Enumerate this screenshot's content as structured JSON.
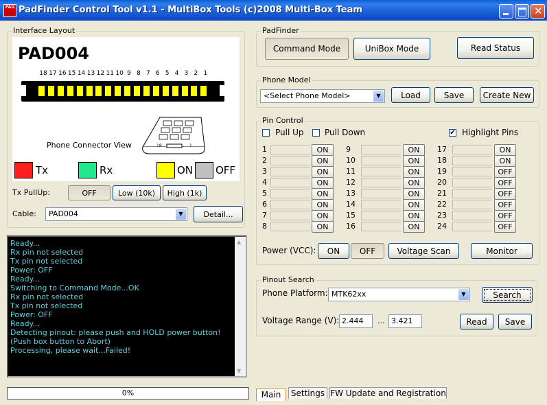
{
  "window": {
    "title": "PadFinder Control Tool v1.1 - MultiBox Tools (c)2008 Multi-Box Team",
    "icon_text": "PAD"
  },
  "interface": {
    "group_label": "Interface Layout",
    "pad_name": "PAD004",
    "pin_numbers": [
      "18",
      "17",
      "16",
      "15",
      "14",
      "13",
      "12",
      "11",
      "10",
      "9",
      "8",
      "7",
      "6",
      "5",
      "4",
      "3",
      "2",
      "1"
    ],
    "phone_connector_label": "Phone Connector View",
    "connector_small_labels": [
      "18",
      "1"
    ],
    "legend": [
      {
        "name": "Tx",
        "color": "#ff1e1e"
      },
      {
        "name": "Rx",
        "color": "#22e88c"
      },
      {
        "name": "ON",
        "color": "#ffff00"
      },
      {
        "name": "OFF",
        "color": "#c0c0c0"
      }
    ],
    "pin_color": "#ffff00"
  },
  "tx_pullup": {
    "label": "Tx PullUp:",
    "options": [
      "OFF",
      "Low (10k)",
      "High (1k)"
    ],
    "selected": "OFF"
  },
  "cable": {
    "label": "Cable:",
    "value": "PAD004",
    "detail_label": "Detail..."
  },
  "log": [
    "Ready...",
    "Rx pin not selected",
    "Tx pin not selected",
    "Power: OFF",
    "Ready...",
    "Switching to Command Mode...OK",
    "Rx pin not selected",
    "Tx pin not selected",
    "Power: OFF",
    "Ready...",
    "Detecting pinout: please push and HOLD power button!",
    "(Push box button to Abort)",
    "Processing, please wait...Failed!"
  ],
  "progress": {
    "value": 0,
    "label": "0%"
  },
  "tabs": [
    "Main",
    "Settings",
    "FW Update and Registration"
  ],
  "padfinder": {
    "group_label": "PadFinder",
    "command_mode": "Command Mode",
    "unibox_mode": "UniBox Mode",
    "read_status": "Read Status"
  },
  "phone_model": {
    "group_label": "Phone Model",
    "value": "<Select Phone Model>",
    "load": "Load",
    "save": "Save",
    "create_new": "Create New"
  },
  "pin_control": {
    "group_label": "Pin Control",
    "pull_up": {
      "label": "Pull Up",
      "checked": false
    },
    "pull_down": {
      "label": "Pull Down",
      "checked": false
    },
    "highlight": {
      "label": "Highlight Pins",
      "checked": true
    },
    "pins": [
      {
        "n": "1",
        "s": "ON"
      },
      {
        "n": "2",
        "s": "ON"
      },
      {
        "n": "3",
        "s": "ON"
      },
      {
        "n": "4",
        "s": "ON"
      },
      {
        "n": "5",
        "s": "ON"
      },
      {
        "n": "6",
        "s": "ON"
      },
      {
        "n": "7",
        "s": "ON"
      },
      {
        "n": "8",
        "s": "ON"
      },
      {
        "n": "9",
        "s": "ON"
      },
      {
        "n": "10",
        "s": "ON"
      },
      {
        "n": "11",
        "s": "ON"
      },
      {
        "n": "12",
        "s": "ON"
      },
      {
        "n": "13",
        "s": "ON"
      },
      {
        "n": "14",
        "s": "ON"
      },
      {
        "n": "15",
        "s": "ON"
      },
      {
        "n": "16",
        "s": "ON"
      },
      {
        "n": "17",
        "s": "ON"
      },
      {
        "n": "18",
        "s": "ON"
      },
      {
        "n": "19",
        "s": "OFF"
      },
      {
        "n": "20",
        "s": "OFF"
      },
      {
        "n": "21",
        "s": "OFF"
      },
      {
        "n": "22",
        "s": "OFF"
      },
      {
        "n": "23",
        "s": "OFF"
      },
      {
        "n": "24",
        "s": "OFF"
      }
    ],
    "power_label": "Power (VCC):",
    "power_on": "ON",
    "power_off": "OFF",
    "voltage_scan": "Voltage Scan",
    "monitor": "Monitor"
  },
  "pinout_search": {
    "group_label": "Pinout Search",
    "platform_label": "Phone Platform:",
    "platform_value": "MTK62xx",
    "search": "Search",
    "voltage_label": "Voltage Range (V):",
    "v_min": "2.444",
    "v_sep": "...",
    "v_max": "3.421",
    "read": "Read",
    "save": "Save"
  }
}
